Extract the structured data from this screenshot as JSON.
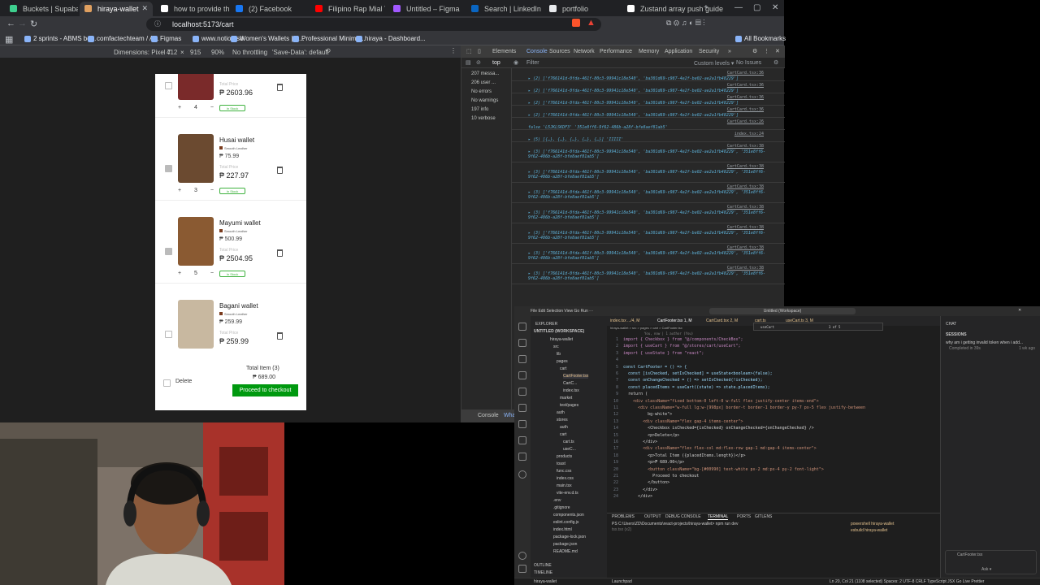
{
  "browser": {
    "tabs": [
      {
        "label": "Buckets | Supabase",
        "color": "#3ecf8e"
      },
      {
        "label": "hiraya-wallet",
        "color": "#e0a060",
        "active": true
      },
      {
        "label": "how to provide the link of",
        "color": "#ffffff"
      },
      {
        "label": "(2) Facebook",
        "color": "#1877f2"
      },
      {
        "label": "Filipino Rap Mial Trenc",
        "color": "#ff0000"
      },
      {
        "label": "Untitled – Figma",
        "color": "#a259ff"
      },
      {
        "label": "Search | LinkedIn",
        "color": "#0a66c2"
      },
      {
        "label": "portfolio",
        "color": "#e8eaed"
      },
      {
        "label": "Zustand array push guide",
        "color": "#ffffff"
      }
    ],
    "url": "localhost:5173/cart",
    "bookmarks": [
      "2 sprints - ABMS bo...",
      "comfactechteam / A...",
      "Figmas",
      "www.notion.so",
      "Women's Wallets | S...",
      "Professional Minima...",
      "hiraya - Dashboard..."
    ],
    "all_bookmarks": "All Bookmarks",
    "device_bar": {
      "dimensions": "Dimensions: Pixel 7",
      "width": "412",
      "x": "×",
      "height": "915",
      "zoom": "90%",
      "throttle": "No throttling",
      "savedata": "'Save-Data': default"
    }
  },
  "cart": {
    "items": [
      {
        "name": "",
        "variant": "",
        "unit_price": "",
        "total_label": "Total Price",
        "total": "₱ 2603.96",
        "qty": "4",
        "stock": "In Stock",
        "checked": false,
        "img": "#7a2a2a"
      },
      {
        "name": "Husai wallet",
        "variant": "Smooth Leather",
        "unit_price": "₱ 75.99",
        "total_label": "Total Price",
        "total": "₱ 227.97",
        "qty": "3",
        "stock": "In Stock",
        "checked": true,
        "img": "#6b4a30"
      },
      {
        "name": "Mayumi wallet",
        "variant": "Smooth Leather",
        "unit_price": "₱ 500.99",
        "total_label": "Total Price",
        "total": "₱ 2504.95",
        "qty": "5",
        "stock": "In Stock",
        "checked": true,
        "img": "#8a5a32"
      },
      {
        "name": "Bagani wallet",
        "variant": "Smooth Leather",
        "unit_price": "₱ 259.99",
        "total_label": "Total Price",
        "total": "₱ 259.99",
        "qty": "",
        "stock": "",
        "checked": false,
        "img": "#c8b8a0"
      }
    ],
    "qty_minus": "−",
    "qty_plus": "+",
    "footer": {
      "delete_label": "Delete",
      "total_items": "Total Item (3)",
      "total": "₱ 689.00",
      "checkout": "Proceed to checkout"
    }
  },
  "devtools": {
    "tabs": [
      "Elements",
      "Console",
      "Sources",
      "Network",
      "Performance",
      "Memory",
      "Application",
      "Security",
      "»"
    ],
    "active_tab": "Console",
    "context": "top",
    "filter_placeholder": "Filter",
    "levels": "Custom levels ▾",
    "issues": "No Issues",
    "sidebar": [
      "207 messa...",
      "206 user ...",
      "No errors",
      "No warnings",
      "197 info",
      "10 verbose"
    ],
    "logs": [
      {
        "body": "▸ (2) ['f766141d-0fda-461f-80c3-99941c18e540', 'ba301d69-c987-4e2f-be02-ae2a1fb48229']",
        "src": "CartCard.tsx:36"
      },
      {
        "body": "▸ (2) ['f766141d-0fda-461f-80c3-99941c18e540', 'ba301d69-c987-4e2f-be02-ae2a1fb48229']",
        "src": "CartCard.tsx:36"
      },
      {
        "body": "▸ (2) ['f766141d-0fda-461f-80c3-99941c18e540', 'ba301d69-c987-4e2f-be02-ae2a1fb48229']",
        "src": "CartCard.tsx:36"
      },
      {
        "body": "▸ (2) ['f766141d-0fda-461f-80c3-99941c18e540', 'ba301d69-c987-4e2f-be02-ae2a1fb48229']",
        "src": "CartCard.tsx:36"
      },
      {
        "body": "false 'L5JKLSKDF3' '351e8ff6-9f62-486b-a28f-bfe8aef81ab5'",
        "src": "CartCard.tsx:26"
      },
      {
        "body": "▸ (5) [{…}, {…}, {…}, {…}, {…}] 'IIIII'",
        "src": "index.tsx:24"
      },
      {
        "body": "▸ (3) ['f766141d-0fda-461f-80c3-99941c18e540', 'ba301d69-c987-4e2f-be02-ae2a1fb48229', '351e8ff6-9f62-486b-a28f-bfe8aef81ab5']",
        "src": "CartCard.tsx:38"
      },
      {
        "body": "▸ (3) ['f766141d-0fda-461f-80c3-99941c18e540', 'ba301d69-c987-4e2f-be02-ae2a1fb48229', '351e8ff6-9f62-486b-a28f-bfe8aef81ab5']",
        "src": "CartCard.tsx:38"
      },
      {
        "body": "▸ (3) ['f766141d-0fda-461f-80c3-99941c18e540', 'ba301d69-c987-4e2f-be02-ae2a1fb48229', '351e8ff6-9f62-486b-a28f-bfe8aef81ab5']",
        "src": "CartCard.tsx:38"
      },
      {
        "body": "▸ (3) ['f766141d-0fda-461f-80c3-99941c18e540', 'ba301d69-c987-4e2f-be02-ae2a1fb48229', '351e8ff6-9f62-486b-a28f-bfe8aef81ab5']",
        "src": "CartCard.tsx:38"
      },
      {
        "body": "▸ (3) ['f766141d-0fda-461f-80c3-99941c18e540', 'ba301d69-c987-4e2f-be02-ae2a1fb48229', '351e8ff6-9f62-486b-a28f-bfe8aef81ab5']",
        "src": "CartCard.tsx:38"
      },
      {
        "body": "▸ (3) ['f766141d-0fda-461f-80c3-99941c18e540', 'ba301d69-c987-4e2f-be02-ae2a1fb48229', '351e8ff6-9f62-486b-a28f-bfe8aef81ab5']",
        "src": "CartCard.tsx:38"
      },
      {
        "body": "▸ (3) ['f766141d-0fda-461f-80c3-99941c18e540', 'ba301d69-c987-4e2f-be02-ae2a1fb48229', '351e8ff6-9f62-486b-a28f-bfe8aef81ab5']",
        "src": "CartCard.tsx:38"
      }
    ],
    "drawer_tabs": [
      "Console",
      "Wha"
    ]
  },
  "vscode": {
    "title_search": "Untitled (Workspace)",
    "explorer_title": "EXPLORER",
    "workspace": "UNTITLED (WORKSPACE)",
    "tree": [
      "hiraya-wallet",
      "src",
      "lib",
      "pages",
      "cart",
      "CartFooter.tsx",
      "CartC...",
      "index.tsx",
      "market",
      "test/pages",
      "auth",
      "stores",
      "auth",
      "cart",
      "cart.ts",
      "useC...",
      "products",
      "toast",
      "func.css",
      "index.css",
      "main.tsx",
      "vite-env.d.ts",
      ".env",
      ".gitignore",
      "components.json",
      "eslint.config.js",
      "index.html",
      "package-lock.json",
      "package.json",
      "README.md"
    ],
    "outline": "OUTLINE",
    "timeline": "TIMELINE",
    "tabs": [
      "index.tsx .../4, M",
      "CartFooter.tsx 1, M",
      "CartCard.tsx 2, M",
      "cart.ts",
      "useCart.ts 3, M"
    ],
    "breadcrumb": "hiraya-wallet > src > pages > cart > CartFooter.tsx",
    "find_value": "useCart",
    "find_count": "3 of 5",
    "code": [
      "import { Checkbox } from \"@/components/CheckBox\";",
      "import { useCart } from \"@/stores/cart/useCart\";",
      "import { useState } from \"react\";",
      "",
      "const CartFooter = () => {",
      "  const [isChecked, setIsChecked] = useState<boolean>(false);",
      "  const onChangeChecked = () => setIsChecked(!isChecked);",
      "  const placedItems = useCart((state) => state.placedItems);",
      "  return (",
      "    <div className=\"fixed bottom-0 left-0 w-full flex justify-center items-end\">",
      "      <div className=\"w-full lg:w-[998px] border-t border-1 border-y py-7 px-5 flex justify-between",
      "          bg-white\">",
      "        <div className=\"flex gap-4 items-center\">",
      "          <Checkbox isChecked={isChecked} onChangeChecked={onChangeChecked} />",
      "          <p>Delete</p>",
      "        </div>",
      "        <div className=\"flex flex-col md:flex-row gap-1 md:gap-4 items-center\">",
      "          <p>Total Item ({placedItems.length})</p>",
      "          <p>₱ 689.00</p>",
      "          <button className=\"bg-[#00990] text-white px-2 md:px-4 py-2 font-light\">",
      "            Proceed to checkout",
      "          </button>",
      "        </div>",
      "      </div>"
    ],
    "blame": "You, now | 1 author (You)",
    "panel_tabs": [
      "PROBLEMS",
      "OUTPUT",
      "DEBUG CONSOLE",
      "TERMINAL",
      "PORTS",
      "GITLENS"
    ],
    "terminal_line": "PS C:\\Users\\ZD\\Documents\\react-projects\\hiraya-wallet> npm run dev",
    "terminal_line2": "tsx.tsx (x2)",
    "terminal_sessions": [
      "powershell hiraya-wallet",
      "esbuild hiraya-wallet"
    ],
    "chat_title": "CHAT",
    "sessions_label": "SESSIONS",
    "chat_item": "why am i getting invalid token when i add...",
    "chat_status": "Completed in 39s",
    "chat_time": "1 wk ago",
    "chat_file": "CartFooter.tsx",
    "chat_input_hint": "Ask ▾",
    "status_left": "hiraya-wallet",
    "status_mid": "Launchpad",
    "status_right": "Ln 20, Col 21 (1108 selected)   Spaces: 2   UTF-8   CRLF   TypeScript JSX   Go Live   Prettier"
  }
}
